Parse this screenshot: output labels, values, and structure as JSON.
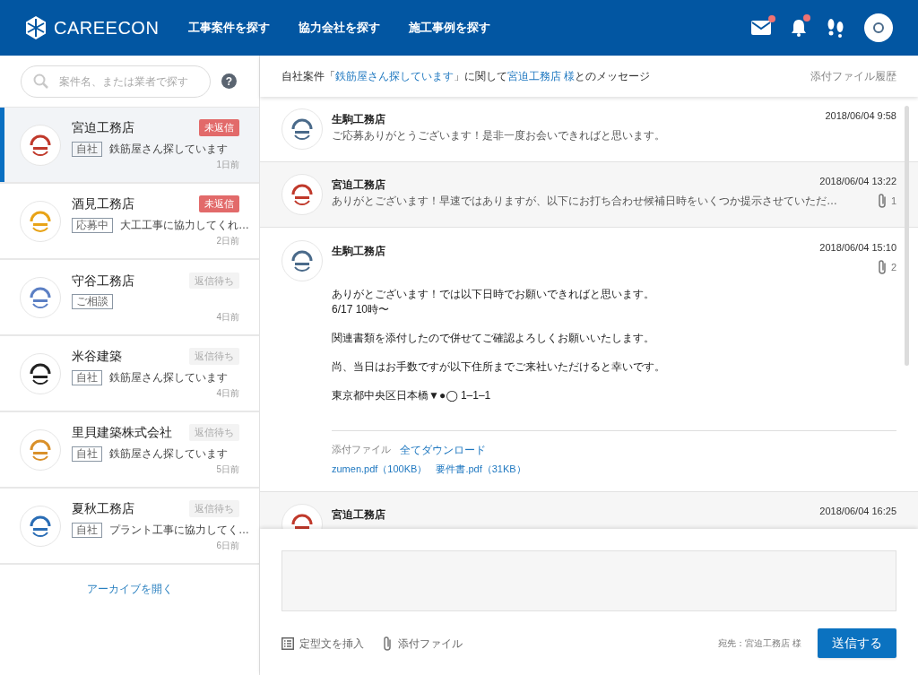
{
  "header": {
    "logo_text": "CAREECON",
    "nav": [
      "工事案件を探す",
      "協力会社を探す",
      "施工事例を探す"
    ],
    "mail_badge": true,
    "bell_badge": true
  },
  "search": {
    "placeholder": "案件名、または業者で探す",
    "help": "?"
  },
  "conversations": [
    {
      "name": "宮迫工務店",
      "status": {
        "kind": "unreplied",
        "label": "未返信"
      },
      "tag": "自社",
      "project": "鉄筋屋さん探しています",
      "age": "1日前",
      "selected": true,
      "color": "#c0392b"
    },
    {
      "name": "酒見工務店",
      "status": {
        "kind": "unreplied",
        "label": "未返信"
      },
      "tag": "応募中",
      "project": "大工工事に協力してくれ…",
      "age": "2日前",
      "selected": false,
      "color": "#e8a317"
    },
    {
      "name": "守谷工務店",
      "status": {
        "kind": "waiting",
        "label": "返信待ち"
      },
      "tag": "ご相談",
      "age": "4日前",
      "selected": false,
      "color": "#5b7fc4"
    },
    {
      "name": "米谷建築",
      "status": {
        "kind": "waiting",
        "label": "返信待ち"
      },
      "tag": "自社",
      "project": "鉄筋屋さん探しています",
      "age": "4日前",
      "selected": false,
      "color": "#222222"
    },
    {
      "name": "里貝建築株式会社",
      "status": {
        "kind": "waiting",
        "label": "返信待ち"
      },
      "tag": "自社",
      "project": "鉄筋屋さん探しています",
      "age": "5日前",
      "selected": false,
      "color": "#d9902a"
    },
    {
      "name": "夏秋工務店",
      "status": {
        "kind": "waiting",
        "label": "返信待ち"
      },
      "tag": "自社",
      "project": "プラント工事に協力してく…",
      "age": "6日前",
      "selected": false,
      "color": "#2a6db5"
    }
  ],
  "archive_link": "アーカイブを開く",
  "thread": {
    "prefix": "自社案件「",
    "project": "鉄筋屋さん探しています",
    "middle": "」に関して",
    "partner": "宮迫工務店 様",
    "suffix": "とのメッセージ",
    "history": "添付ファイル履歴"
  },
  "messages": [
    {
      "sender": "生駒工務店",
      "time": "2018/06/04 9:58",
      "own": true,
      "expanded": false,
      "preview": "ご応募ありがとうございます！是非一度お会いできればと思います。",
      "color": "#4a6a8a"
    },
    {
      "sender": "宮迫工務店",
      "time": "2018/06/04 13:22",
      "own": false,
      "expanded": false,
      "preview": "ありがとございます！早速ではありますが、以下にお打ち合わせ候補日時をいくつか提示させていただ…",
      "attachments": "1",
      "color": "#c0392b"
    },
    {
      "sender": "生駒工務店",
      "time": "2018/06/04 15:10",
      "own": true,
      "expanded": true,
      "attachments": "2",
      "color": "#4a6a8a",
      "paragraphs": [
        [
          "ありがとございます！では以下日時でお願いできればと思います。",
          "6/17 10時〜"
        ],
        [
          "関連書類を添付したので併せてご確認よろしくお願いいたします。"
        ],
        [
          "尚、当日はお手数ですが以下住所までご来社いただけると幸いです。"
        ],
        [
          "東京都中央区日本橋▼●◯ 1–1–1"
        ]
      ],
      "files_label": "添付ファイル",
      "download_all": "全てダウンロード",
      "files": [
        "zumen.pdf（100KB）",
        "要件書.pdf（31KB）"
      ]
    },
    {
      "sender": "宮迫工務店",
      "time": "2018/06/04 16:25",
      "own": false,
      "expanded": false,
      "color": "#c0392b"
    }
  ],
  "composer": {
    "template": "定型文を挿入",
    "attach": "添付ファイル",
    "recipient": "宛先：宮迫工務店 様",
    "send": "送信する"
  }
}
